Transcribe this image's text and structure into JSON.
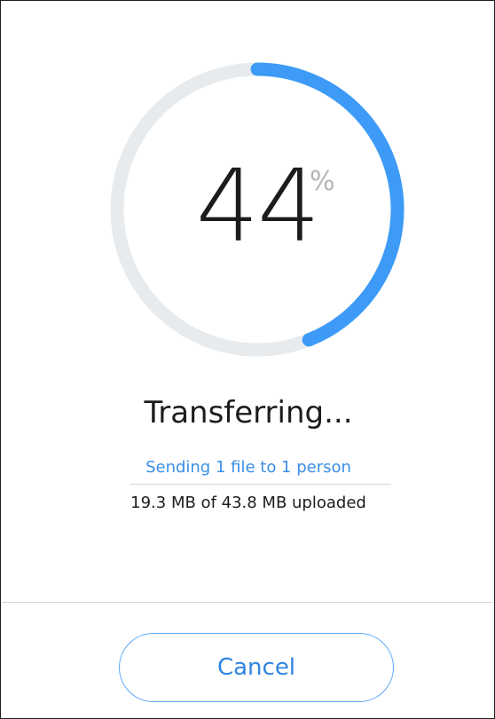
{
  "progress": {
    "percent_value": "44",
    "percent_sign": "%",
    "fraction": 0.44,
    "track_color": "#e8ebee",
    "fill_color": "#3d9bf7"
  },
  "status": {
    "title": "Transferring..."
  },
  "details": {
    "sending_text": "Sending 1 file to 1 person",
    "uploaded_text": "19.3 MB of 43.8 MB uploaded"
  },
  "actions": {
    "cancel_label": "Cancel"
  }
}
